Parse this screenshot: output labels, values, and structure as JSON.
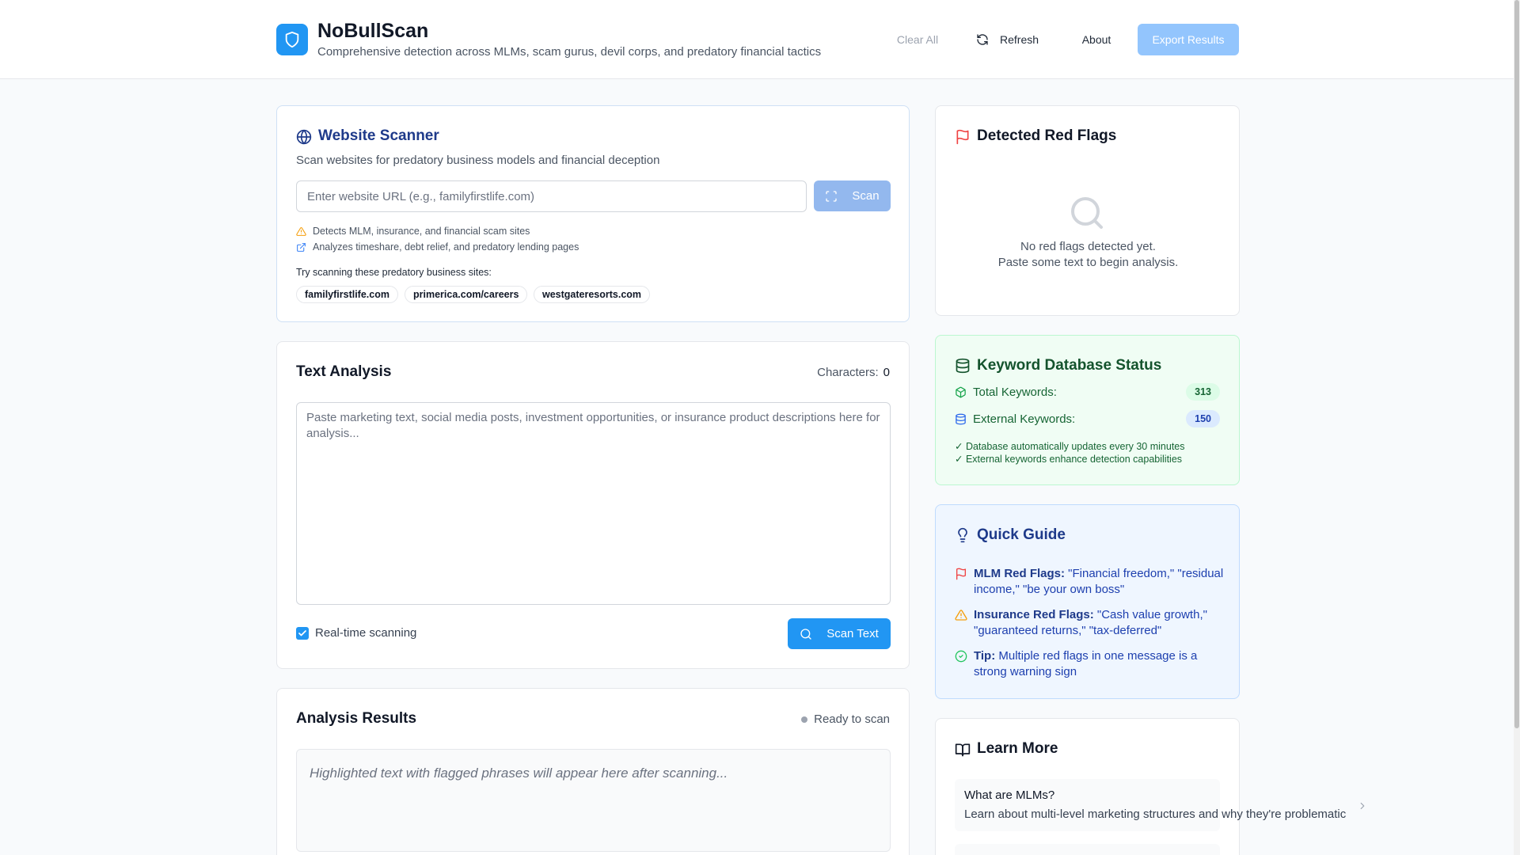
{
  "header": {
    "title": "NoBullScan",
    "subtitle": "Comprehensive detection across MLMs, scam gurus, devil corps, and predatory financial tactics",
    "clear_all": "Clear All",
    "refresh": "Refresh",
    "about": "About",
    "export": "Export Results"
  },
  "website_scanner": {
    "title": "Website Scanner",
    "description": "Scan websites for predatory business models and financial deception",
    "url_placeholder": "Enter website URL (e.g., familyfirstlife.com)",
    "scan_label": "Scan",
    "notes": [
      "Detects MLM, insurance, and financial scam sites",
      "Analyzes timeshare, debt relief, and predatory lending pages"
    ],
    "try_label": "Try scanning these predatory business sites:",
    "examples": [
      "familyfirstlife.com",
      "primerica.com/careers",
      "westgateresorts.com"
    ]
  },
  "text_analysis": {
    "title": "Text Analysis",
    "characters_label": "Characters:",
    "characters_count": "0",
    "textarea_placeholder": "Paste marketing text, social media posts, investment opportunities, or insurance product descriptions here for analysis...",
    "realtime_label": "Real-time scanning",
    "realtime_checked": true,
    "scan_text_label": "Scan Text"
  },
  "analysis_results": {
    "title": "Analysis Results",
    "status": "Ready to scan",
    "placeholder": "Highlighted text with flagged phrases will appear here after scanning..."
  },
  "detected_flags": {
    "title": "Detected Red Flags",
    "empty_line1": "No red flags detected yet.",
    "empty_line2": "Paste some text to begin analysis."
  },
  "keyword_db": {
    "title": "Keyword Database Status",
    "total_label": "Total Keywords:",
    "total_value": "313",
    "external_label": "External Keywords:",
    "external_value": "150",
    "note1": "✓ Database automatically updates every 30 minutes",
    "note2": "✓ External keywords enhance detection capabilities"
  },
  "quick_guide": {
    "title": "Quick Guide",
    "items": [
      {
        "label": "MLM Red Flags:",
        "text": " \"Financial freedom,\" \"residual income,\" \"be your own boss\""
      },
      {
        "label": "Insurance Red Flags:",
        "text": " \"Cash value growth,\" \"guaranteed returns,\" \"tax-deferred\""
      },
      {
        "label": "Tip:",
        "text": " Multiple red flags in one message is a strong warning sign"
      }
    ]
  },
  "learn_more": {
    "title": "Learn More",
    "items": [
      {
        "title": "What are MLMs?",
        "description": "Learn about multi-level marketing structures and why they're problematic"
      }
    ]
  },
  "colors": {
    "primary": "#2196f3",
    "primary_light": "#93c5fd",
    "green_bg": "#f0fdf4",
    "blue_bg": "#eff6ff",
    "red_flag": "#ef4444",
    "warning": "#f59e0b"
  }
}
